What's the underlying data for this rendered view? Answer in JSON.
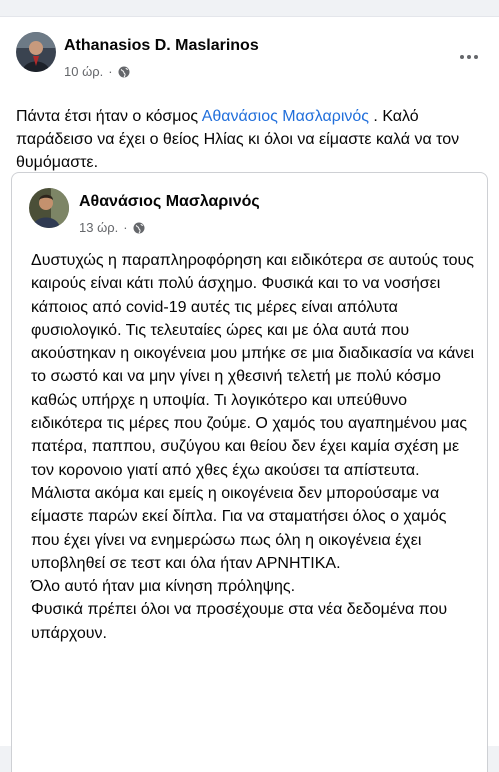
{
  "post": {
    "author": "Athanasios D. Maslarinos",
    "time": "10 ώρ.",
    "separator": "·",
    "privacy_icon": "globe-icon",
    "more_icon": "more-options-icon",
    "text_before": "Πάντα έτσι ήταν ο κόσμος ",
    "mention": "Αθανάσιος Μασλαρινός",
    "text_after": " . Καλό παράδεισο να έχει ο θείος Ηλίας κι όλοι να είμαστε καλά να τον θυμόμαστε."
  },
  "shared": {
    "author": "Αθανάσιος Μασλαρινός",
    "time": "13 ώρ.",
    "separator": "·",
    "privacy_icon": "globe-icon",
    "paragraphs": [
      "Δυστυχώς η παραπληροφόρηση και ειδικότερα σε αυτούς τους καιρούς είναι κάτι πολύ άσχημο. Φυσικά και το να νοσήσει κάποιος από covid-19 αυτές τις μέρες είναι απόλυτα φυσιολογικό. Τις τελευταίες ώρες και με όλα αυτά που ακούστηκαν η οικογένεια μου μπήκε σε μια διαδικασία να κάνει το σωστό και να μην γίνει η χθεσινή τελετή με πολύ κόσμο καθώς υπήρχε η υποψία. Τι λογικότερο και υπεύθυνο ειδικότερα τις μέρες που ζούμε. Ο χαμός του αγαπημένου μας πατέρα, παππου, συζύγου και θείου δεν έχει καμία σχέση με τον κορονοιο γιατί από χθες έχω ακούσει τα απίστευτα. Μάλιστα ακόμα και εμείς η οικογένεια δεν μπορούσαμε να είμαστε παρών εκεί δίπλα. Για να σταματήσει όλος ο χαμός που έχει γίνει να ενημερώσω πως όλη η οικογένεια έχει υποβληθεί σε τεστ και όλα ήταν ΑΡΝΗΤΙΚΑ.",
      "Όλο αυτό ήταν μια κίνηση πρόληψης.",
      "Φυσικά πρέπει όλοι να προσέχουμε στα νέα δεδομένα που υπάρχουν."
    ]
  },
  "colors": {
    "link": "#216fdb",
    "secondary_text": "#65676b",
    "border": "#ced0d4",
    "background": "#f0f2f5"
  }
}
